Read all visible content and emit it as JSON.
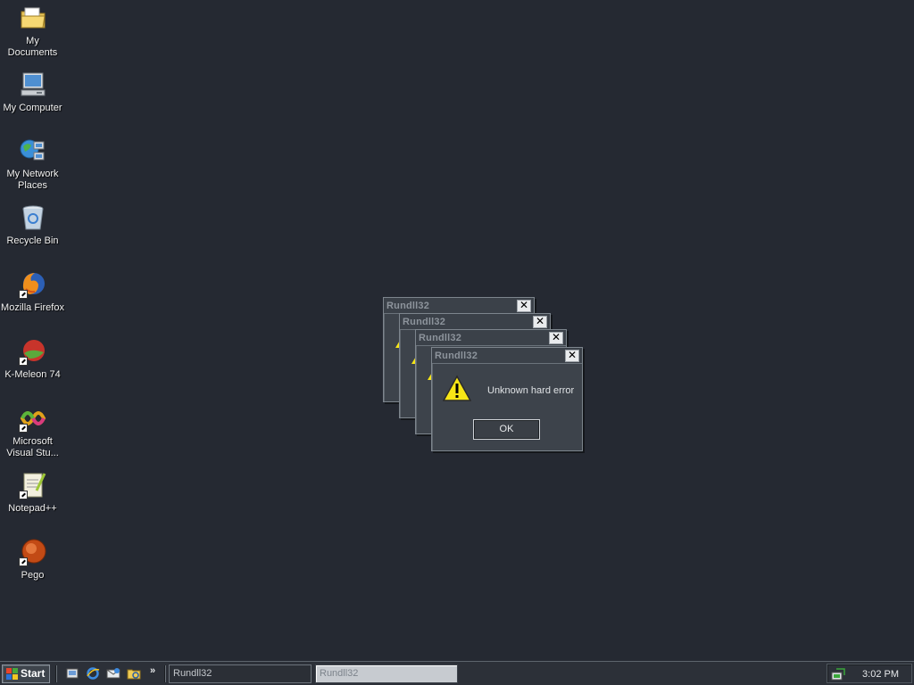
{
  "desktop": {
    "icons": [
      {
        "label": "My Documents",
        "icon": "my-documents-folder-icon"
      },
      {
        "label": "My Computer",
        "icon": "my-computer-icon"
      },
      {
        "label": "My Network Places",
        "icon": "network-places-icon"
      },
      {
        "label": "Recycle Bin",
        "icon": "recycle-bin-icon"
      },
      {
        "label": "Mozilla Firefox",
        "icon": "firefox-icon"
      },
      {
        "label": "K-Meleon 74",
        "icon": "k-meleon-icon"
      },
      {
        "label": "Microsoft Visual Stu...",
        "icon": "visual-studio-icon"
      },
      {
        "label": "Notepad++",
        "icon": "notepad-plus-plus-icon"
      },
      {
        "label": "Pego",
        "icon": "pego-icon"
      }
    ]
  },
  "dialogs": [
    {
      "title": "Rundll32"
    },
    {
      "title": "Rundll32"
    },
    {
      "title": "Rundll32"
    },
    {
      "title": "Rundll32",
      "message": "Unknown hard error",
      "ok_label": "OK"
    }
  ],
  "taskbar": {
    "start_label": "Start",
    "quick_launch": [
      "show-desktop-icon",
      "internet-explorer-icon",
      "outlook-express-icon",
      "windows-explorer-icon"
    ],
    "chevron": "»",
    "tasks": [
      {
        "label": "Rundll32",
        "active": false
      },
      {
        "label": "Rundll32",
        "active": true
      }
    ],
    "clock": "3:02 PM"
  },
  "colors": {
    "desktop_bg": "#252932",
    "taskbar_bg": "#2c3038",
    "dialog_bg": "#3d434b",
    "warning_yellow": "#f7e616"
  }
}
